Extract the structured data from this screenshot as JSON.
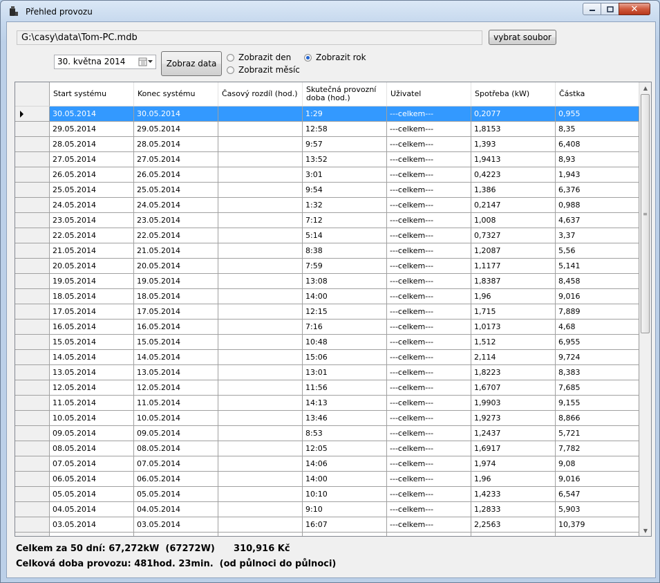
{
  "window": {
    "title": "Přehled provozu"
  },
  "controls": {
    "file_path": "G:\\casy\\data\\Tom-PC.mdb",
    "select_file_label": "vybrat soubor",
    "date_value": "30.  května   2014",
    "show_data_label": "Zobraz data",
    "radio_day": "Zobrazit den",
    "radio_month": "Zobrazit měsíc",
    "radio_year": "Zobrazit rok",
    "selected_radio": "year"
  },
  "grid": {
    "columns": [
      "Start systému",
      "Konec systému",
      "Časový rozdíl (hod.)",
      "Skutečná provozní doba (hod.)",
      "Uživatel",
      "Spotřeba (kW)",
      "Částka"
    ],
    "selected_row": 0,
    "rows": [
      [
        "30.05.2014",
        "30.05.2014",
        "",
        "1:29",
        "---celkem---",
        "0,2077",
        "0,955"
      ],
      [
        "29.05.2014",
        "29.05.2014",
        "",
        "12:58",
        "---celkem---",
        "1,8153",
        "8,35"
      ],
      [
        "28.05.2014",
        "28.05.2014",
        "",
        "9:57",
        "---celkem---",
        "1,393",
        "6,408"
      ],
      [
        "27.05.2014",
        "27.05.2014",
        "",
        "13:52",
        "---celkem---",
        "1,9413",
        "8,93"
      ],
      [
        "26.05.2014",
        "26.05.2014",
        "",
        "3:01",
        "---celkem---",
        "0,4223",
        "1,943"
      ],
      [
        "25.05.2014",
        "25.05.2014",
        "",
        "9:54",
        "---celkem---",
        "1,386",
        "6,376"
      ],
      [
        "24.05.2014",
        "24.05.2014",
        "",
        "1:32",
        "---celkem---",
        "0,2147",
        "0,988"
      ],
      [
        "23.05.2014",
        "23.05.2014",
        "",
        "7:12",
        "---celkem---",
        "1,008",
        "4,637"
      ],
      [
        "22.05.2014",
        "22.05.2014",
        "",
        "5:14",
        "---celkem---",
        "0,7327",
        "3,37"
      ],
      [
        "21.05.2014",
        "21.05.2014",
        "",
        "8:38",
        "---celkem---",
        "1,2087",
        "5,56"
      ],
      [
        "20.05.2014",
        "20.05.2014",
        "",
        "7:59",
        "---celkem---",
        "1,1177",
        "5,141"
      ],
      [
        "19.05.2014",
        "19.05.2014",
        "",
        "13:08",
        "---celkem---",
        "1,8387",
        "8,458"
      ],
      [
        "18.05.2014",
        "18.05.2014",
        "",
        "14:00",
        "---celkem---",
        "1,96",
        "9,016"
      ],
      [
        "17.05.2014",
        "17.05.2014",
        "",
        "12:15",
        "---celkem---",
        "1,715",
        "7,889"
      ],
      [
        "16.05.2014",
        "16.05.2014",
        "",
        "7:16",
        "---celkem---",
        "1,0173",
        "4,68"
      ],
      [
        "15.05.2014",
        "15.05.2014",
        "",
        "10:48",
        "---celkem---",
        "1,512",
        "6,955"
      ],
      [
        "14.05.2014",
        "14.05.2014",
        "",
        "15:06",
        "---celkem---",
        "2,114",
        "9,724"
      ],
      [
        "13.05.2014",
        "13.05.2014",
        "",
        "13:01",
        "---celkem---",
        "1,8223",
        "8,383"
      ],
      [
        "12.05.2014",
        "12.05.2014",
        "",
        "11:56",
        "---celkem---",
        "1,6707",
        "7,685"
      ],
      [
        "11.05.2014",
        "11.05.2014",
        "",
        "14:13",
        "---celkem---",
        "1,9903",
        "9,155"
      ],
      [
        "10.05.2014",
        "10.05.2014",
        "",
        "13:46",
        "---celkem---",
        "1,9273",
        "8,866"
      ],
      [
        "09.05.2014",
        "09.05.2014",
        "",
        "8:53",
        "---celkem---",
        "1,2437",
        "5,721"
      ],
      [
        "08.05.2014",
        "08.05.2014",
        "",
        "12:05",
        "---celkem---",
        "1,6917",
        "7,782"
      ],
      [
        "07.05.2014",
        "07.05.2014",
        "",
        "14:06",
        "---celkem---",
        "1,974",
        "9,08"
      ],
      [
        "06.05.2014",
        "06.05.2014",
        "",
        "14:00",
        "---celkem---",
        "1,96",
        "9,016"
      ],
      [
        "05.05.2014",
        "05.05.2014",
        "",
        "10:10",
        "---celkem---",
        "1,4233",
        "6,547"
      ],
      [
        "04.05.2014",
        "04.05.2014",
        "",
        "9:10",
        "---celkem---",
        "1,2833",
        "5,903"
      ],
      [
        "03.05.2014",
        "03.05.2014",
        "",
        "16:07",
        "---celkem---",
        "2,2563",
        "10,379"
      ],
      [
        "",
        "",
        "",
        "",
        "",
        "",
        ""
      ]
    ]
  },
  "summary": {
    "line1": "Celkem za 50 dní: 67,272kW  (67272W)      310,916 Kč",
    "line2": "Celková doba provozu: 481hod. 23min.  (od půlnoci do půlnoci)"
  },
  "colors": {
    "selection": "#3399ff",
    "accent": "#1f62d0"
  }
}
